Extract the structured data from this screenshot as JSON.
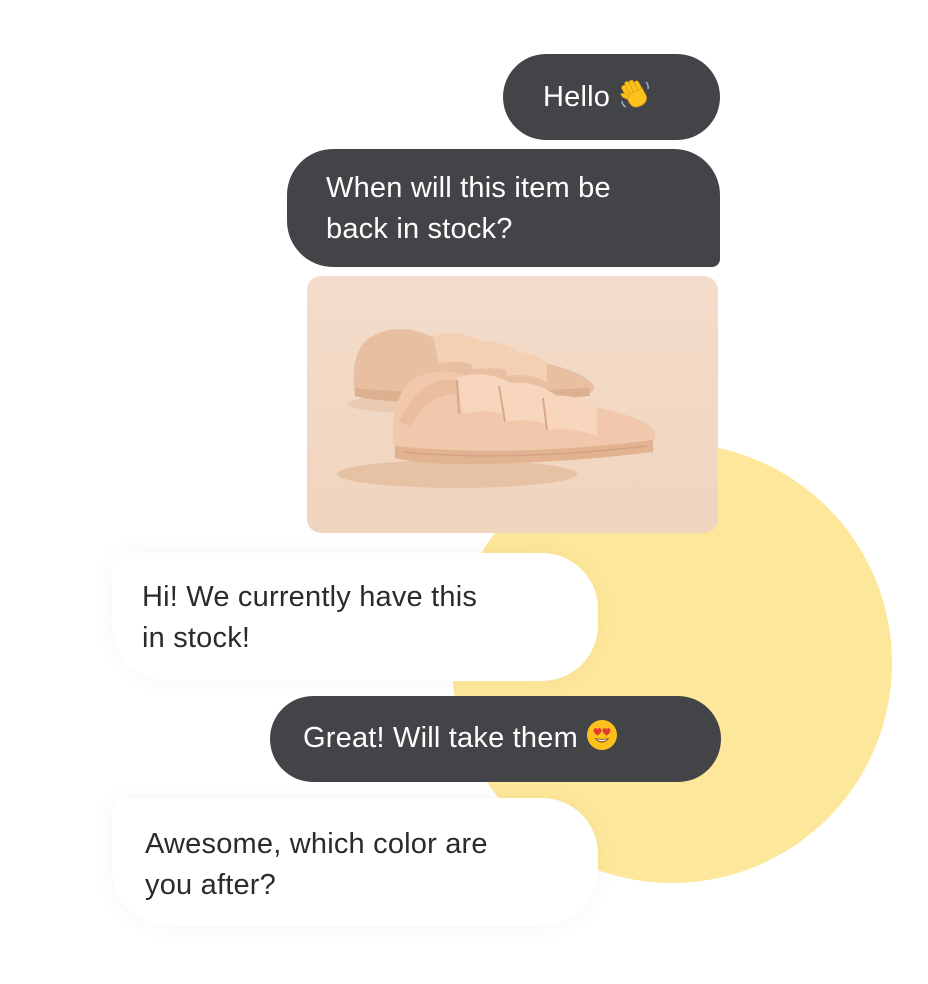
{
  "colors": {
    "outgoing_bubble": "#434447",
    "incoming_text": "#2a2b2e",
    "accent_circle": "#fde79a",
    "photo_background": "#f3dcca",
    "shoe": "#efc5a8"
  },
  "messages": [
    {
      "direction": "outgoing",
      "text": "Hello",
      "emoji": "waving-hand-emoji"
    },
    {
      "direction": "outgoing",
      "lines": [
        "When will this item be",
        "back in stock?"
      ]
    },
    {
      "direction": "outgoing",
      "type": "image",
      "image": "sneakers-photo"
    },
    {
      "direction": "incoming",
      "lines": [
        "Hi! We currently have this",
        "in stock!"
      ]
    },
    {
      "direction": "outgoing",
      "text": "Great! Will take them",
      "emoji": "heart-eyes-emoji"
    },
    {
      "direction": "incoming",
      "lines": [
        "Awesome, which color are",
        "you after?"
      ]
    }
  ]
}
